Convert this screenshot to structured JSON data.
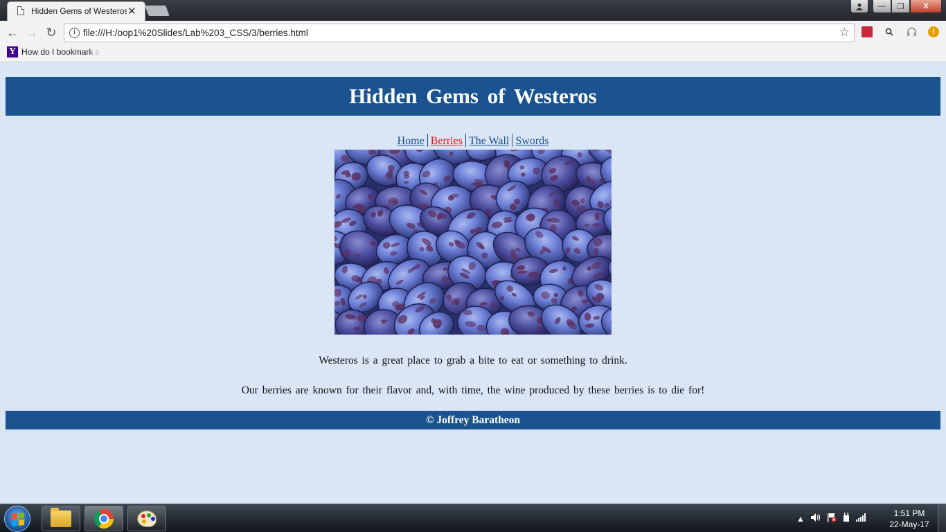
{
  "browser": {
    "tab_title": "Hidden Gems of Westeros",
    "tab_close": "✕",
    "url": "file:///H:/oop1%20Slides/Lab%203_CSS/3/berries.html",
    "info_glyph": "i",
    "star_glyph": "☆",
    "bookmark_label": "How do I bookmark a",
    "bookmark_icon_letter": "Y",
    "window_controls": {
      "minimize": "—",
      "maximize": "❐",
      "close": "X"
    },
    "nav_glyphs": {
      "back": "←",
      "forward": "→",
      "reload": "↻"
    },
    "icons": [
      "page-icon",
      "info-icon",
      "star-icon",
      "yahoo-icon",
      "user-icon",
      "search-icon",
      "headphones-icon",
      "alert-icon"
    ]
  },
  "page": {
    "title": "Hidden Gems of Westeros",
    "nav": [
      {
        "label": "Home",
        "active": false
      },
      {
        "label": "Berries",
        "active": true
      },
      {
        "label": "The Wall",
        "active": false
      },
      {
        "label": "Swords",
        "active": false
      }
    ],
    "image_subject": "pile of blue plums",
    "intro": "Westeros is a great place to grab a bite to eat or something to drink.",
    "berries_text": "Our berries are known for their flavor and, with time, the wine produced by these berries is to die for!",
    "footer": "© Joffrey Baratheon",
    "colors": {
      "banner": "#1a538f",
      "background": "#dae6f6",
      "link": "#1a4e8a",
      "active_link": "#e41b17"
    }
  },
  "taskbar": {
    "clock_time": "1:51 PM",
    "clock_date": "22-May-17",
    "apps": [
      "windows-explorer",
      "google-chrome",
      "paint"
    ],
    "tray_icons": [
      "show-hidden-icons",
      "volume-icon",
      "action-center-flag-icon",
      "power-icon",
      "network-signal-icon"
    ]
  }
}
